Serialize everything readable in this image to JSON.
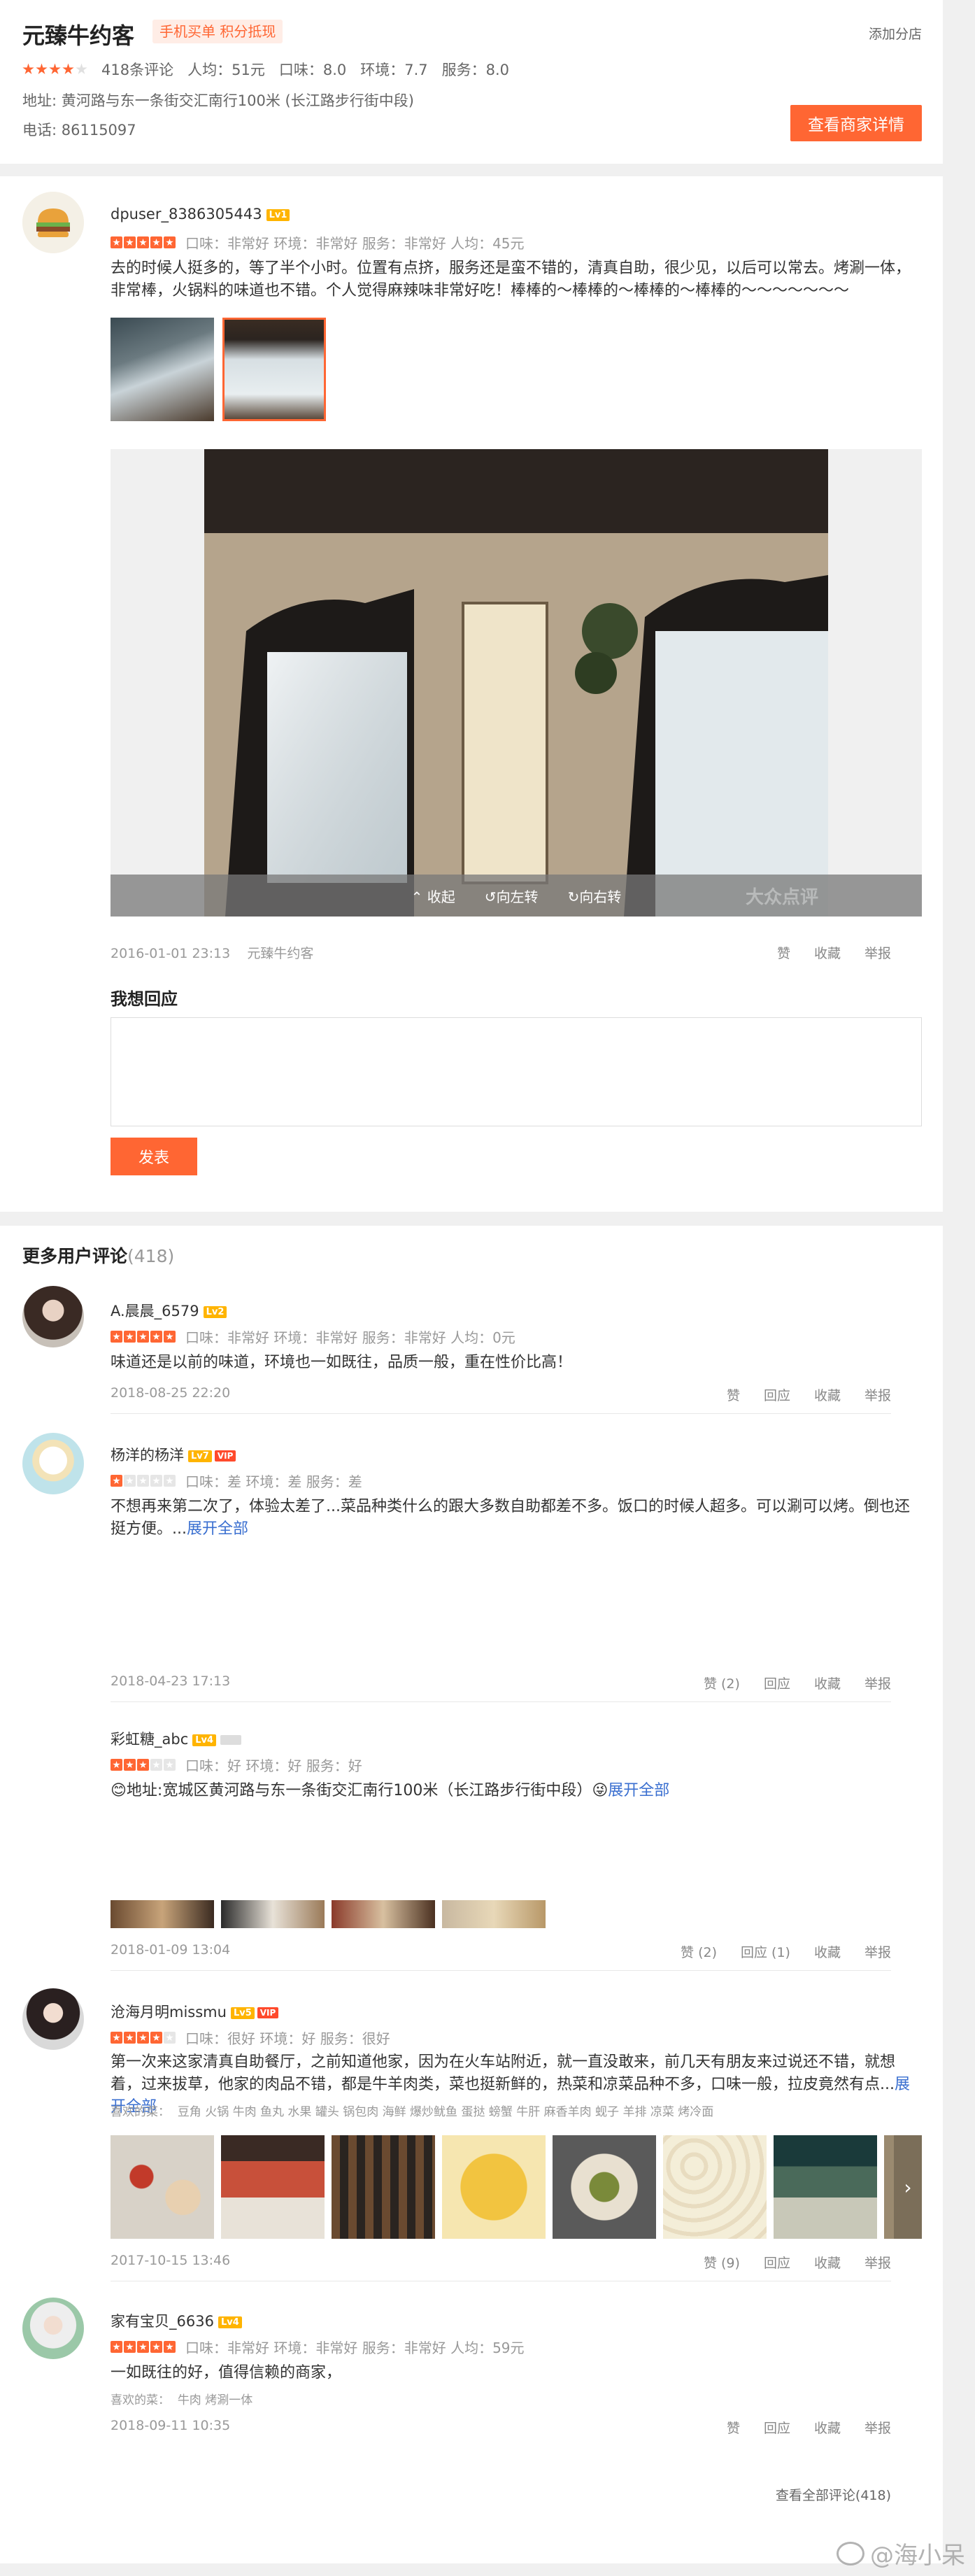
{
  "header": {
    "title": "元臻牛约客",
    "tag": "手机买单 积分抵现",
    "add_branch": "添加分店",
    "review_count": "418条评论",
    "avg": "人均：51元",
    "taste": "口味：8.0",
    "env": "环境：7.7",
    "service": "服务：8.0",
    "address": "地址: 黄河路与东一条街交汇南行100米 (长江路步行街中段)",
    "phone": "电话: 86115097",
    "detail_button": "查看商家详情",
    "rating": 4
  },
  "main_review": {
    "user": "dpuser_8386305443",
    "level": "Lv1",
    "rating": 5,
    "scores": "口味：非常好  环境：非常好  服务：非常好  人均：45元",
    "text": "去的时候人挺多的，等了半个小时。位置有点挤，服务还是蛮不错的，清真自助，很少见，以后可以常去。烤涮一体，非常棒，火锅料的味道也不错。个人觉得麻辣味非常好吃！棒棒的～棒棒的～棒棒的～棒棒的～～～～～～～",
    "viewer_actions": [
      "收起",
      "向左转",
      "向右转"
    ],
    "watermark": "大众点评",
    "date": "2016-01-01 23:13",
    "shop": "元臻牛约客",
    "actions": [
      "赞",
      "收藏",
      "举报"
    ],
    "reply_title": "我想回应",
    "reply_placeholder": "",
    "submit": "发表"
  },
  "more": {
    "title": "更多用户评论",
    "count": "(418)",
    "view_all": "查看全部评论(418)",
    "reviews": [
      {
        "user": "A.晨晨_6579",
        "level": "Lv2",
        "rating": 5,
        "scores": "口味：非常好  环境：非常好  服务：非常好  人均：0元",
        "text": "味道还是以前的味道，环境也一如既往，品质一般，重在性价比高！",
        "date": "2018-08-25 22:20",
        "actions": [
          "赞",
          "回应",
          "收藏",
          "举报"
        ]
      },
      {
        "user": "杨洋的杨洋",
        "level": "Lv7",
        "vip": "VIP",
        "rating": 1,
        "scores": "口味：差  环境：差  服务：差",
        "text": "不想再来第二次了，体验太差了...菜品种类什么的跟大多数自助都差不多。饭口的时候人超多。可以涮可以烤。倒也还挺方便。...",
        "expand": "展开全部",
        "date": "2018-04-23 17:13",
        "actions": [
          "赞 (2)",
          "回应",
          "收藏",
          "举报"
        ]
      },
      {
        "user": "彩虹糖_abc",
        "level": "Lv4",
        "rating": 3,
        "scores": "口味：好  环境：好  服务：好",
        "text": "😊地址:宽城区黄河路与东一条街交汇南行100米（长江路步行街中段）😜",
        "expand": "展开全部",
        "date": "2018-01-09 13:04",
        "actions": [
          "赞 (2)",
          "回应 (1)",
          "收藏",
          "举报"
        ]
      },
      {
        "user": "沧海月明missmu",
        "level": "Lv5",
        "vip": "VIP",
        "rating": 4,
        "scores": "口味：很好  环境：好  服务：很好",
        "text": "第一次来这家清真自助餐厅，之前知道他家，因为在火车站附近，就一直没敢来，前几天有朋友来过说还不错，就想着，过来拔草，他家的肉品不错，都是牛羊肉类，菜也挺新鲜的，热菜和凉菜品种不多，口味一般，拉皮竟然有点...",
        "expand": "展开全部",
        "likes_label": "喜欢的菜：",
        "likes": "豆角  火锅  牛肉  鱼丸  水果  罐头  锅包肉  海鲜  爆炒鱿鱼  蛋挞  螃蟹  牛肝  麻香羊肉  蚬子  羊排  凉菜  烤冷面",
        "date": "2017-10-15 13:46",
        "actions": [
          "赞 (9)",
          "回应",
          "收藏",
          "举报"
        ]
      },
      {
        "user": "家有宝贝_6636",
        "level": "Lv4",
        "rating": 5,
        "scores": "口味：非常好  环境：非常好  服务：非常好  人均：59元",
        "text": "一如既往的好，值得信赖的商家，",
        "likes_label": "喜欢的菜：",
        "likes": "牛肉  烤涮一体",
        "date": "2018-09-11 10:35",
        "actions": [
          "赞",
          "回应",
          "收藏",
          "举报"
        ]
      }
    ]
  },
  "watermark": "@海小呆",
  "colors": {
    "accent": "#ff6633",
    "link": "#3a6fd0",
    "star_off": "#e0e0e0"
  },
  "icons": [
    "chevron-up-icon",
    "rotate-left-icon",
    "rotate-right-icon",
    "chevron-right-icon",
    "weibo-icon"
  ]
}
